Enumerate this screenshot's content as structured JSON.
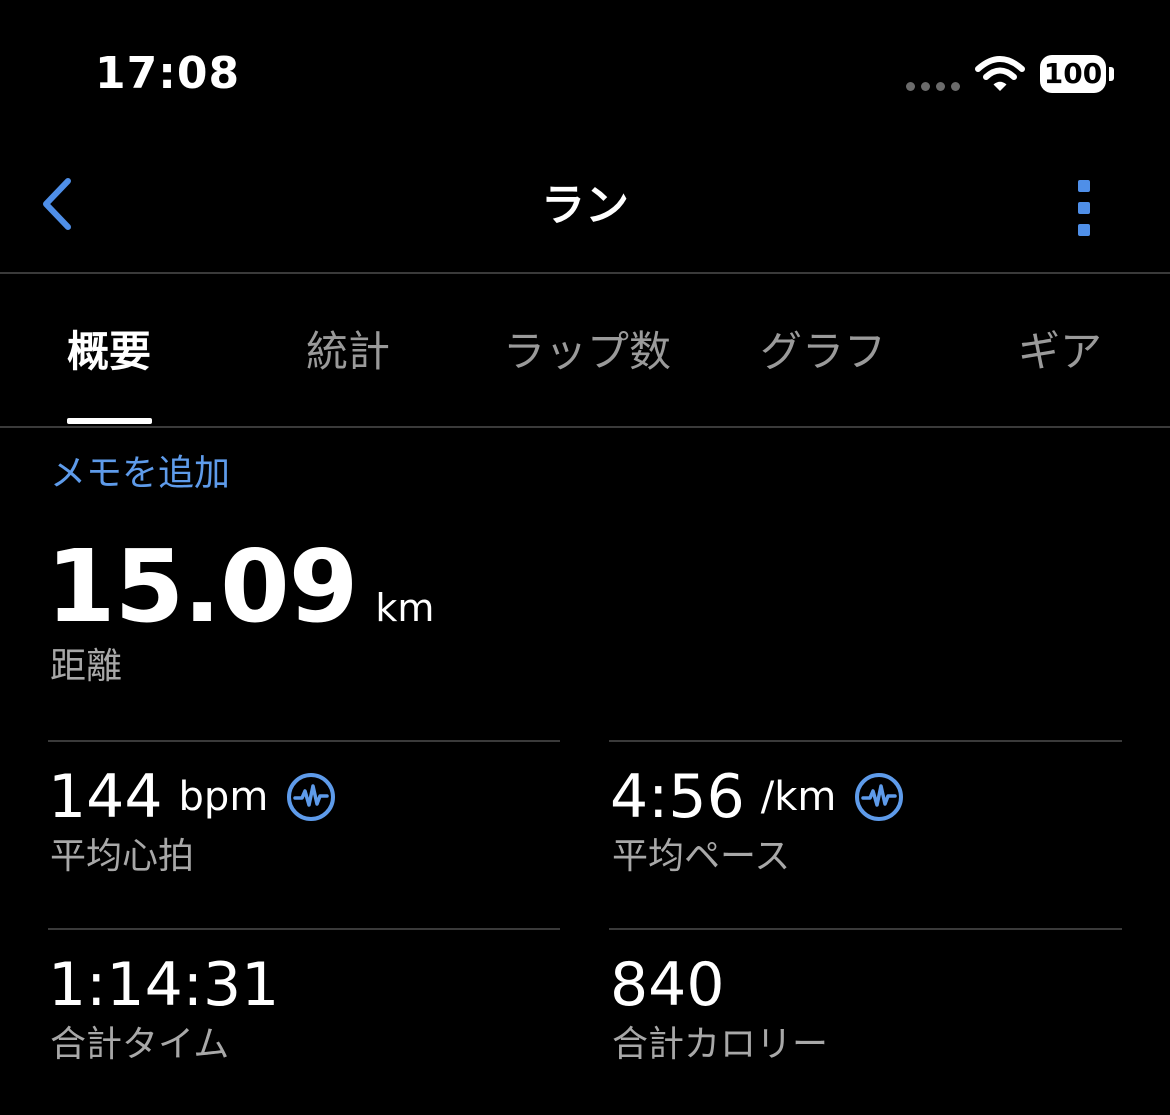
{
  "status_bar": {
    "time": "17:08",
    "battery": "100"
  },
  "nav": {
    "title": "ラン"
  },
  "tabs": [
    {
      "label": "概要",
      "active": true
    },
    {
      "label": "統計",
      "active": false
    },
    {
      "label": "ラップ数",
      "active": false
    },
    {
      "label": "グラフ",
      "active": false
    },
    {
      "label": "ギア",
      "active": false
    }
  ],
  "memo_link": "メモを追加",
  "distance": {
    "value": "15.09",
    "unit": "km",
    "label": "距離"
  },
  "stats": {
    "heart_rate": {
      "value": "144",
      "unit": "bpm",
      "label": "平均心拍"
    },
    "pace": {
      "value": "4:56",
      "unit": "/km",
      "label": "平均ペース"
    },
    "time": {
      "value": "1:14:31",
      "label": "合計タイム"
    },
    "calories": {
      "value": "840",
      "label": "合計カロリー"
    }
  },
  "colors": {
    "background": "#000000",
    "accent": "#5e9bea",
    "secondary_text": "#a8a8a8",
    "divider": "#3a3a3a"
  },
  "icons": {
    "back": "chevron-left-icon",
    "more": "more-vertical-icon",
    "heart_rate_source": "heart-rate-pulse-icon",
    "wifi": "wifi-icon",
    "battery": "battery-icon"
  }
}
